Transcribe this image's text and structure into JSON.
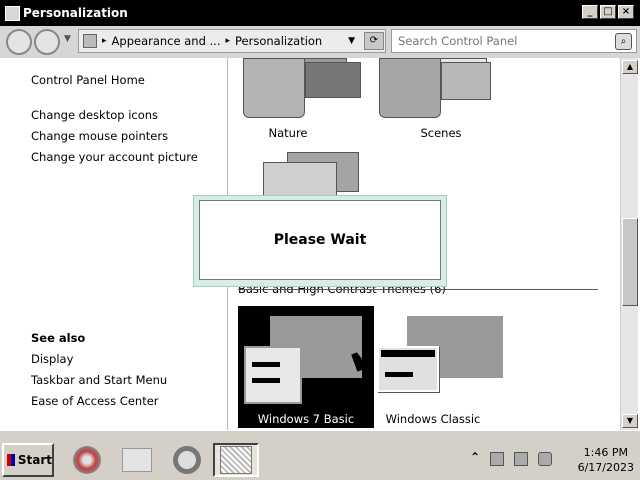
{
  "window": {
    "title": "Personalization",
    "controls": {
      "minimize": "_",
      "maximize": "□",
      "close": "×"
    }
  },
  "addressbar": {
    "crumbs": [
      "Appearance and ...",
      "Personalization"
    ],
    "search_placeholder": "Search Control Panel"
  },
  "sidebar": {
    "links": [
      "Control Panel Home",
      "Change desktop icons",
      "Change mouse pointers",
      "Change your account picture"
    ],
    "see_also_heading": "See also",
    "see_also_links": [
      "Display",
      "Taskbar and Start Menu",
      "Ease of Access Center"
    ]
  },
  "themes": {
    "top_items": [
      "Nature",
      "Scenes"
    ],
    "section_header": "Basic and High Contrast Themes (6)",
    "basic_items": [
      "Windows 7 Basic",
      "Windows Classic"
    ],
    "selected": "Windows 7 Basic"
  },
  "dialog": {
    "message": "Please Wait"
  },
  "taskbar": {
    "start_label": "Start",
    "clock_time": "1:46 PM",
    "clock_date": "6/17/2023",
    "tray_expand": "⌃"
  }
}
